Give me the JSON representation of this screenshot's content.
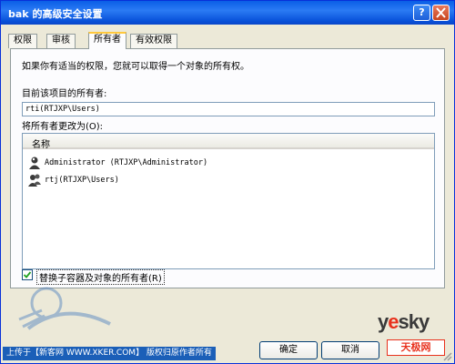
{
  "window": {
    "title": "bak 的高级安全设置",
    "help_label": "?",
    "close_label": "X"
  },
  "tabs": [
    {
      "label": "权限"
    },
    {
      "label": "审核"
    },
    {
      "label": "所有者",
      "active": true
    },
    {
      "label": "有效权限"
    }
  ],
  "owner_tab": {
    "instructions": "如果你有适当的权限，您就可以取得一个对象的所有权。",
    "current_owner_label": "目前该项目的所有者:",
    "current_owner_value": "rti(RTJXP\\Users)",
    "change_owner_label": "将所有者更改为(O):",
    "list_header": "名称",
    "owners": [
      {
        "name": "Administrator (RTJXP\\Administrator)",
        "icon": "single-user-icon"
      },
      {
        "name": "rtj(RTJXP\\Users)",
        "icon": "user-group-icon"
      }
    ],
    "replace_checkbox_label": "替换子容器及对象的所有者(R)",
    "replace_checked": true
  },
  "buttons": {
    "ok": "确定",
    "cancel": "取消"
  },
  "credit": "上传于【新客网 WWW.XKER.COM】 版权归原作者所有",
  "brand": {
    "logo_y": "y",
    "logo_e": "e",
    "logo_sky": "sky",
    "tianji": "天极网"
  },
  "colors": {
    "titlebar": "#0a5ee6",
    "panel": "#fcfcfe",
    "window_bg": "#ece9d8",
    "accent_tab": "#ffc83c",
    "brand_red": "#e8311d"
  }
}
